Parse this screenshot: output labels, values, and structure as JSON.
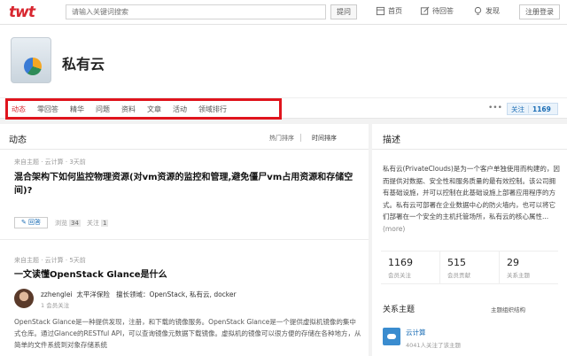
{
  "top": {
    "logo": "twt",
    "search_placeholder": "请输入关键词搜索",
    "search_button": "提问",
    "nav": [
      {
        "label": "首页",
        "icon": "home-icon"
      },
      {
        "label": "待回答",
        "icon": "edit-icon"
      },
      {
        "label": "发现",
        "icon": "bulb-icon"
      }
    ],
    "login": "注册登录"
  },
  "topic": {
    "title": "私有云"
  },
  "tabs": [
    "动态",
    "零回答",
    "精华",
    "问题",
    "资料",
    "文章",
    "活动",
    "领域排行"
  ],
  "tab_active_index": 0,
  "follow": {
    "label": "关注",
    "count": "1169"
  },
  "feed": {
    "heading": "动态",
    "sort_hot": "热门排序",
    "sort_time": "时间排序",
    "items": [
      {
        "meta": "来自主题 · 云计算 · 3天前",
        "title": "混合架构下如何监控物理资源(对vm资源的监控和管理,避免僵尸vm占用资源和存储空间)?",
        "answer_label": "回答",
        "views_label": "浏览",
        "views": "34",
        "follows_label": "关注",
        "follows": "1"
      },
      {
        "meta": "来自主题 · 云计算 · 5天前",
        "title": "一文读懂OpenStack Glance是什么",
        "author": "zzhenglei",
        "author_org": "太平洋保险",
        "expertise": "擅长领域：OpenStack, 私有云, docker",
        "author_sub": "1 会员关注",
        "body": "OpenStack Glance是一种提供发现，注册，和下载的镜像服务。OpenStack Glance是一个提供虚拟机镜像的集中式仓库。通过Glance的RESTful API，可以查询镜像元数据下载镜像。虚拟机的镜像可以很方便的存储在各种地方，从简单的文件系统到对象存储系统"
      }
    ]
  },
  "side": {
    "heading": "描述",
    "description": "私有云(PrivateClouds)是为一个客户单独使用而构建的，因而提供对数据、安全性和服务质量的最有效控制。该公司拥有基础设施，并可以控制在此基础设施上部署应用程序的方式。私有云可部署在企业数据中心的防火墙内，也可以将它们部署在一个安全的主机托管场所，私有云的核心属性...",
    "more": "(more)",
    "stats": [
      {
        "num": "1169",
        "label": "会员关注"
      },
      {
        "num": "515",
        "label": "会员贡献"
      },
      {
        "num": "29",
        "label": "关系主题"
      }
    ],
    "related_heading": "关系主题",
    "related_link": "主题组织结构",
    "related_item": {
      "name": "云计算",
      "sub": "4041人关注了该主题"
    }
  },
  "colors": {
    "accent": "#d8262f",
    "link": "#1b6db5",
    "highlight_box": "#e0141d"
  }
}
